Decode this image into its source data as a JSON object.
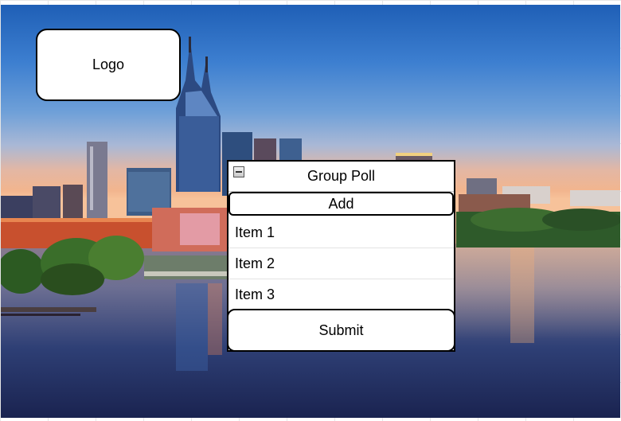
{
  "logo": {
    "label": "Logo"
  },
  "poll": {
    "title": "Group Poll",
    "add_label": "Add",
    "items": [
      "Item 1",
      "Item 2",
      "Item 3"
    ],
    "submit_label": "Submit"
  },
  "icons": {
    "collapse": "minus-square-icon"
  },
  "colors": {
    "panel_bg": "#ffffff",
    "border": "#000000",
    "text": "#000000"
  }
}
